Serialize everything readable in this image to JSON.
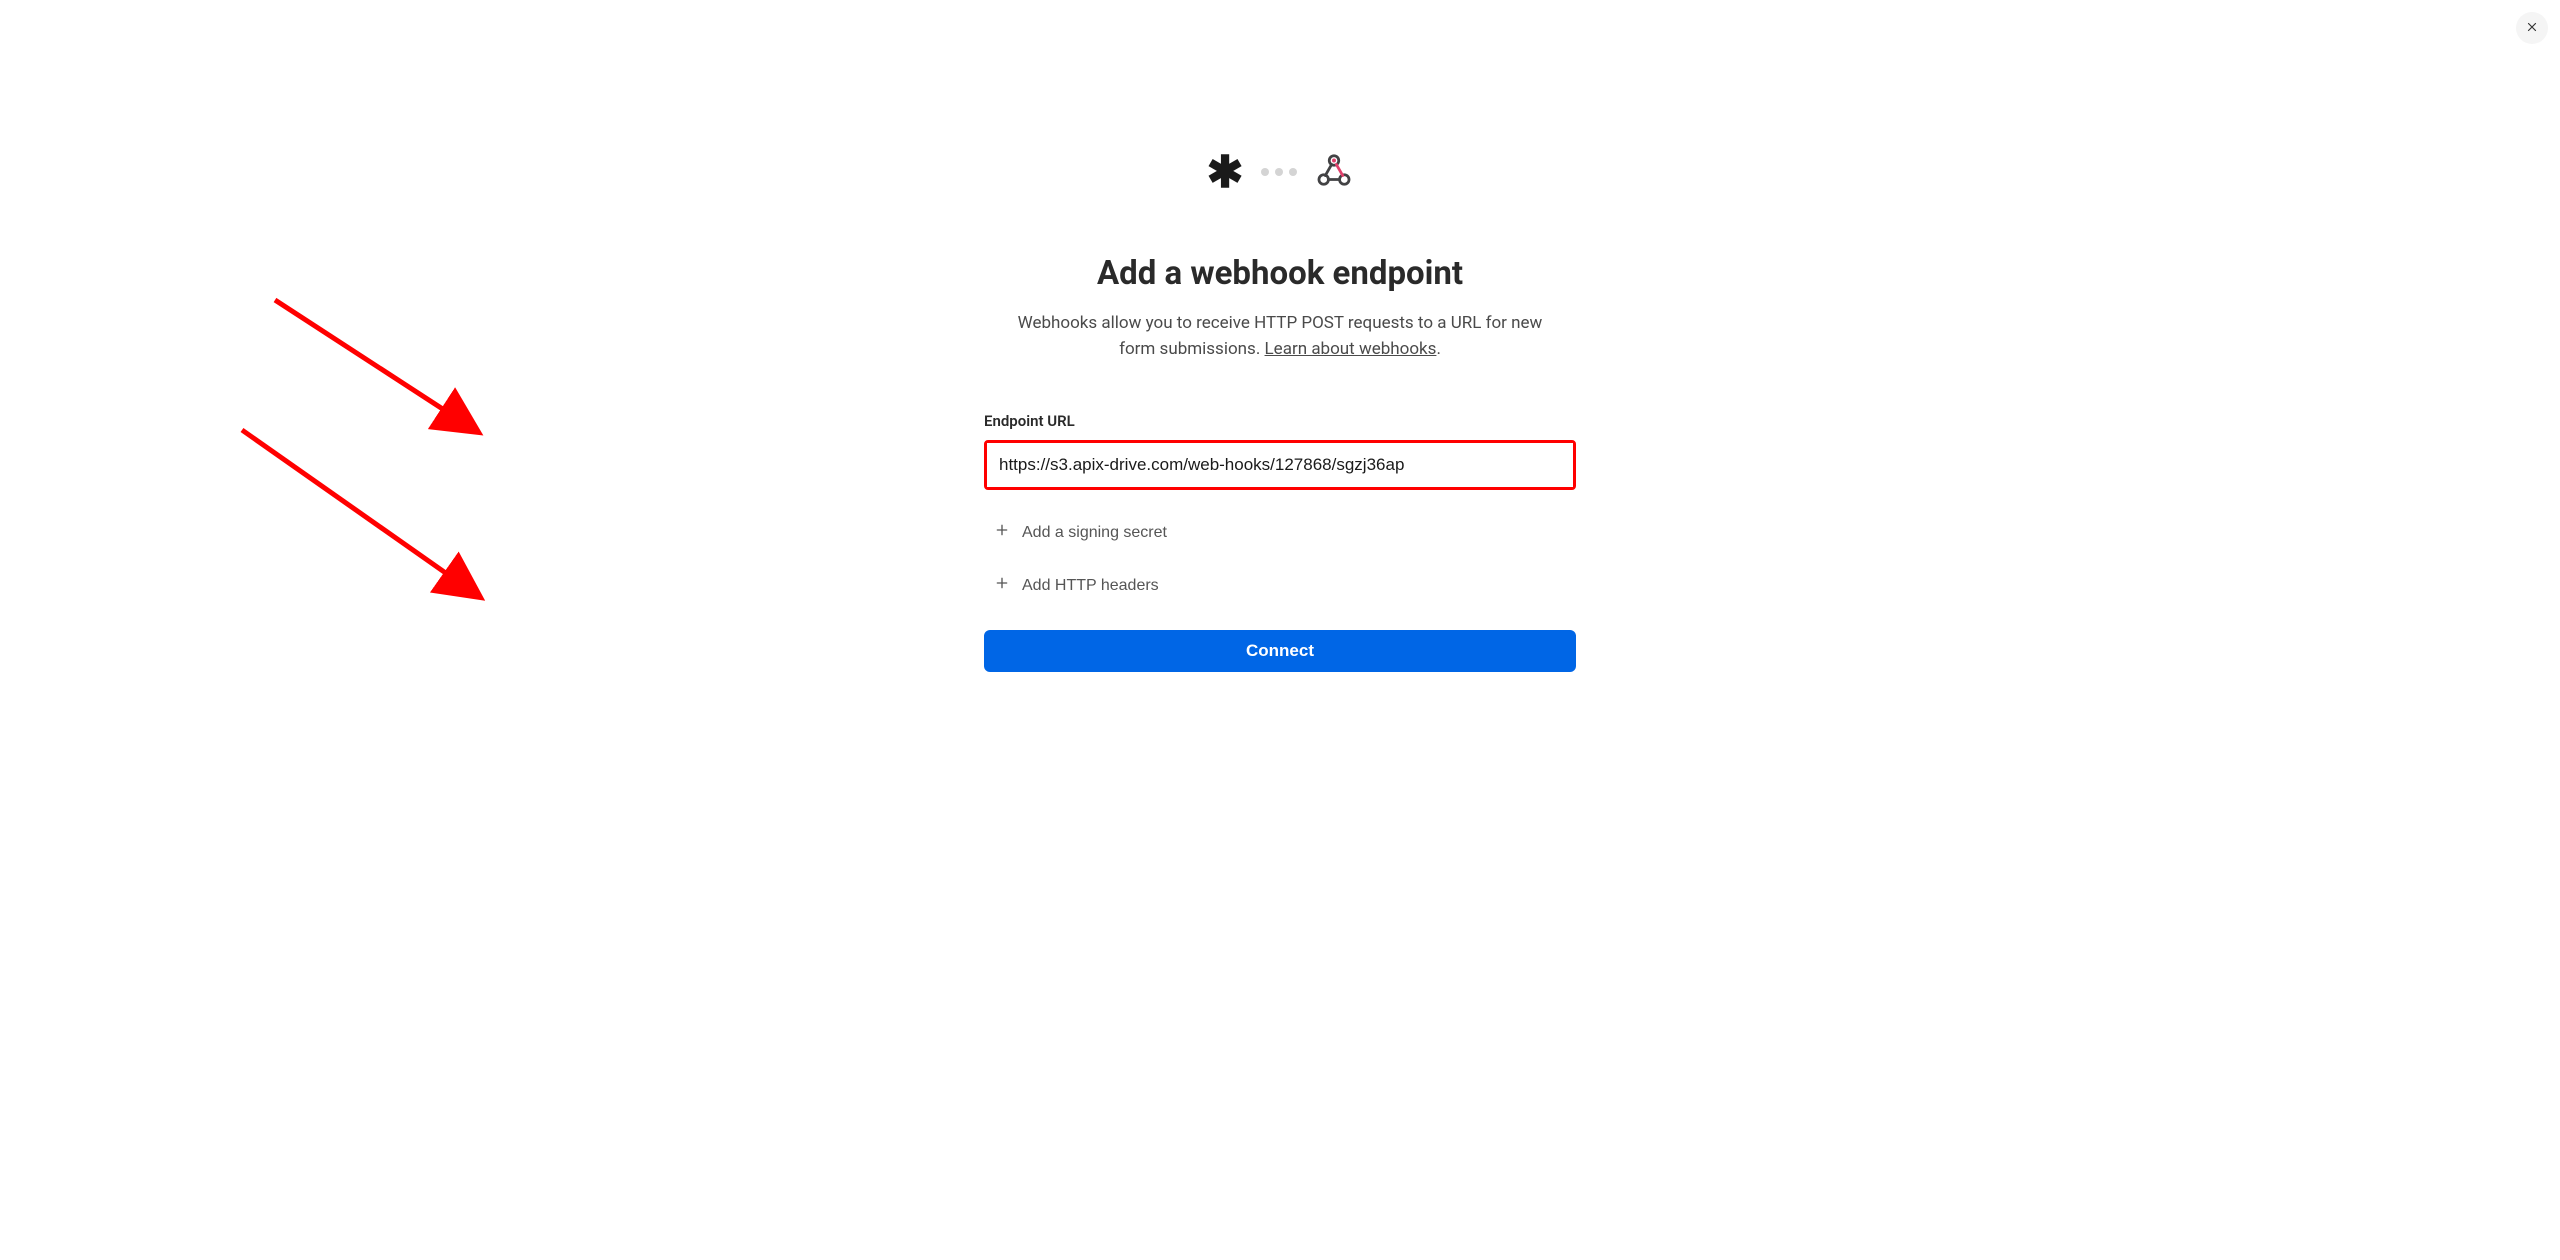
{
  "modal": {
    "title": "Add a webhook endpoint",
    "description_prefix": "Webhooks allow you to receive HTTP POST requests to a URL for new form submissions. ",
    "learn_link": "Learn about webhooks",
    "description_suffix": "."
  },
  "form": {
    "endpoint_label": "Endpoint URL",
    "endpoint_value": "https://s3.apix-drive.com/web-hooks/127868/sgzj36ap",
    "add_signing_secret": "Add a signing secret",
    "add_http_headers": "Add HTTP headers",
    "connect_button": "Connect"
  },
  "annotations": {
    "arrow_color": "#ff0000"
  }
}
